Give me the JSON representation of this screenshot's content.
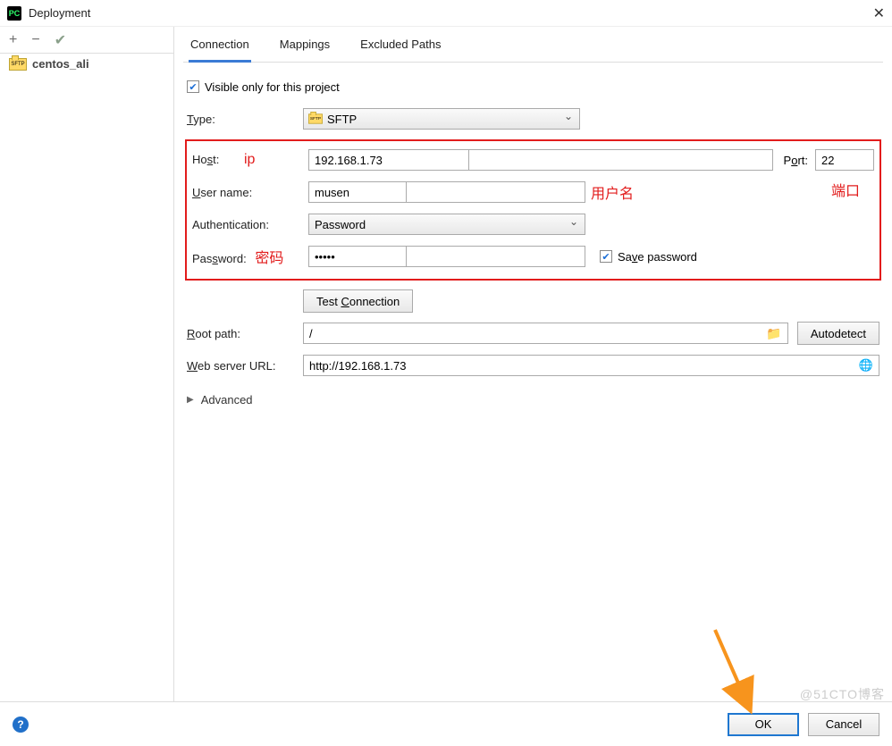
{
  "window": {
    "title": "Deployment"
  },
  "sidebar": {
    "items": [
      {
        "label": "centos_ali"
      }
    ]
  },
  "tabs": [
    {
      "label": "Connection",
      "active": true
    },
    {
      "label": "Mappings"
    },
    {
      "label": "Excluded Paths"
    }
  ],
  "form": {
    "visible_only": "Visible only for this project",
    "labels": {
      "type": "Type:",
      "host": "Host:",
      "port": "Port:",
      "username": "User name:",
      "auth": "Authentication:",
      "password": "Password:",
      "save_password": "Save password",
      "root_path": "Root path:",
      "web_url": "Web server URL:"
    },
    "values": {
      "type": "SFTP",
      "host": "192.168.1.73",
      "port": "22",
      "username": "musen",
      "auth": "Password",
      "password": "•••••",
      "root_path": "/",
      "web_url": "http://192.168.1.73"
    },
    "buttons": {
      "test": "Test Connection",
      "autodetect": "Autodetect"
    },
    "advanced": "Advanced"
  },
  "annotations": {
    "ip": "ip",
    "username": "用户名",
    "port": "端口",
    "password": "密码"
  },
  "footer": {
    "ok": "OK",
    "cancel": "Cancel"
  },
  "watermark": "@51CTO博客"
}
